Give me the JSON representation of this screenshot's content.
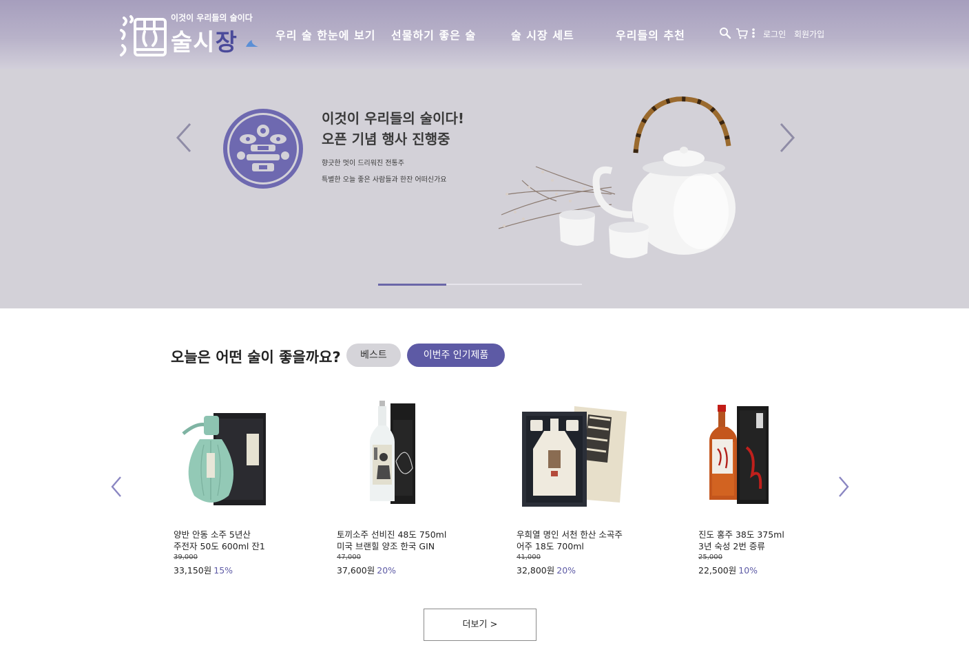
{
  "brand": {
    "tagline": "이것이 우리들의 술이다",
    "name_part1": "술시",
    "name_part2": "장"
  },
  "nav": {
    "items": [
      {
        "label": "우리 술 한눈에 보기"
      },
      {
        "label": "선물하기 좋은 술"
      },
      {
        "label": "술 시장 세트"
      },
      {
        "label": "우리들의 추천"
      }
    ]
  },
  "util": {
    "icons": [
      "search-icon",
      "cart-icon",
      "more-vertical-icon"
    ],
    "login": "로그인",
    "signup": "회원가입"
  },
  "hero": {
    "title_line1": "이것이 우리들의 술이다!",
    "title_line2": "오픈 기념 행사 진행중",
    "sub_line1": "향긋한 멋이 드리워진 전통주",
    "sub_line2": "특별한 오늘 좋은 사람들과 한잔 어떠신가요",
    "progress": 0.333,
    "colors": {
      "background": "#d3d1d8",
      "accent": "#6a66a8"
    }
  },
  "section": {
    "title": "오늘은 어떤 술이 좋을까요?",
    "tabs": [
      {
        "label": "베스트",
        "active": false
      },
      {
        "label": "이번주 인기제품",
        "active": true
      }
    ]
  },
  "products": [
    {
      "name_line1": "양반 안동 소주 5년산",
      "name_line2": "주전자 50도 600ml 잔1",
      "original_price": "39,000",
      "price": "33,150원",
      "discount": "15%"
    },
    {
      "name_line1": "토끼소주 선비진 48도 750ml",
      "name_line2": "미국 브랜힐 양조 한국 GIN",
      "original_price": "47,000",
      "price": "37,600원",
      "discount": "20%"
    },
    {
      "name_line1": "우희열 명인 서천 한산 소곡주",
      "name_line2": "어주 18도 700ml",
      "original_price": "41,000",
      "price": "32,800원",
      "discount": "20%"
    },
    {
      "name_line1": "진도 홍주 38도 375ml",
      "name_line2": "3년 숙성 2번 증류",
      "original_price": "25,000",
      "price": "22,500원",
      "discount": "10%"
    }
  ],
  "more_button": "더보기 >",
  "colors": {
    "brand_purple": "#5d5aa5",
    "header": "#a69ebd"
  }
}
